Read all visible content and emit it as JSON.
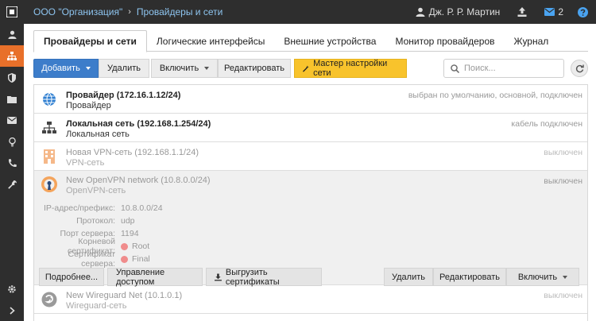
{
  "topbar": {
    "org": "ООО \"Организация\"",
    "separator": "›",
    "current": "Провайдеры и сети",
    "user": "Дж. Р. Р. Мартин",
    "mail_count": "2"
  },
  "sidebar": {
    "items": [
      "user-icon",
      "network-icon",
      "shield-icon",
      "folder-icon",
      "mail-icon",
      "bulb-icon",
      "phone-icon",
      "wrench-icon"
    ],
    "bottom": [
      "gear-icon",
      "chevron-right-icon"
    ]
  },
  "tabs": [
    {
      "label": "Провайдеры и сети"
    },
    {
      "label": "Логические интерфейсы"
    },
    {
      "label": "Внешние устройства"
    },
    {
      "label": "Монитор провайдеров"
    },
    {
      "label": "Журнал"
    }
  ],
  "toolbar": {
    "add": "Добавить",
    "delete": "Удалить",
    "enable": "Включить",
    "edit": "Редактировать",
    "wizard": "Мастер настройки сети",
    "search_placeholder": "Поиск..."
  },
  "rows": [
    {
      "title": "Провайдер (172.16.1.12/24)",
      "subtitle": "Провайдер",
      "status": "выбран по умолчанию, основной, подключен"
    },
    {
      "title": "Локальная сеть (192.168.1.254/24)",
      "subtitle": "Локальная сеть",
      "status": "кабель подключен"
    },
    {
      "title": "Новая VPN-сеть (192.168.1.1/24)",
      "subtitle": "VPN-сеть",
      "status": "выключен"
    }
  ],
  "expanded": {
    "title": "New OpenVPN network (10.8.0.0/24)",
    "subtitle": "OpenVPN-сеть",
    "status": "выключен",
    "details": [
      {
        "key": "IP-адрес/префикс:",
        "value": "10.8.0.0/24"
      },
      {
        "key": "Протокол:",
        "value": "udp"
      },
      {
        "key": "Порт сервера:",
        "value": "1194"
      },
      {
        "key": "Корневой сертификат:",
        "value": "Root"
      },
      {
        "key": "Сертификат сервера:",
        "value": "Final"
      }
    ],
    "actions": {
      "more": "Подробнее...",
      "access": "Управление доступом",
      "export": "Выгрузить сертификаты",
      "delete": "Удалить",
      "edit": "Редактировать",
      "enable": "Включить"
    }
  },
  "last_row": {
    "title": "New Wireguard Net (10.1.0.1)",
    "subtitle": "Wireguard-сеть",
    "status": "выключен"
  },
  "colors": {
    "accent_blue": "#3d7dca",
    "wizard_yellow": "#f8c32c",
    "sidebar_active": "#e8702a",
    "topbar": "#2e2e2e",
    "cert_dot": "#f08c8c"
  }
}
